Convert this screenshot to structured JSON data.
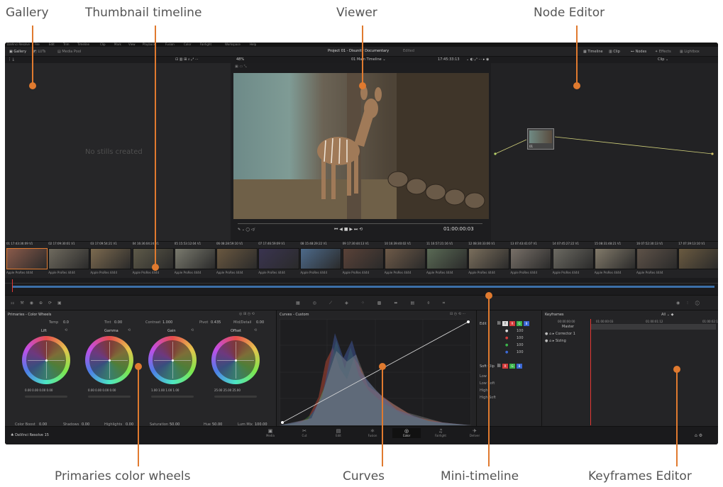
{
  "callouts": {
    "gallery": "Gallery",
    "thumbnail_timeline": "Thumbnail timeline",
    "viewer": "Viewer",
    "node_editor": "Node Editor",
    "primaries": "Primaries color wheels",
    "curves": "Curves",
    "mini_timeline": "Mini-timeline",
    "keyframes": "Keyframes Editor"
  },
  "menubar": {
    "app": "DaVinci Resolve",
    "items": [
      "File",
      "Edit",
      "Trim",
      "Timeline",
      "Clip",
      "Mark",
      "View",
      "Playback",
      "Fusion",
      "Color",
      "Fairlight",
      "Workspace",
      "Help"
    ]
  },
  "header": {
    "gallery": "Gallery",
    "luts": "LUTs",
    "media_pool": "Media Pool",
    "project_title": "Project 01 - Disunity Documentary",
    "project_status": "Edited",
    "timeline": "Timeline",
    "clip": "Clip",
    "nodes": "Nodes",
    "effects": "Effects",
    "lightbox": "Lightbox"
  },
  "subbar": {
    "zoom": "48%",
    "timeline_name": "01 Main Timeline",
    "timecode": "17:45:33:13",
    "clip_mode": "Clip"
  },
  "gallery": {
    "empty_text": "No stills created"
  },
  "viewer": {
    "timecode": "01:00:00:03"
  },
  "node": {
    "label": "01"
  },
  "clips": [
    {
      "num": "01",
      "tc": "17:43:36:09",
      "track": "V1",
      "label": "Apple ProRes 4444",
      "color": "#8a5a4a"
    },
    {
      "num": "02",
      "tc": "17:09:30:01",
      "track": "V1",
      "label": "Apple ProRes 4444",
      "color": "#6f6a5e"
    },
    {
      "num": "03",
      "tc": "17:09:54:21",
      "track": "V1",
      "label": "Apple ProRes 4444",
      "color": "#7c6a4f"
    },
    {
      "num": "04",
      "tc": "16:36:04:24",
      "track": "V1",
      "label": "Apple ProRes 4444",
      "color": "#5e5a49"
    },
    {
      "num": "05",
      "tc": "15:53:12:04",
      "track": "V1",
      "label": "Apple ProRes 4444",
      "color": "#7a7a6e"
    },
    {
      "num": "06",
      "tc": "08:28:59:10",
      "track": "V1",
      "label": "Apple ProRes 4444",
      "color": "#6a5840"
    },
    {
      "num": "07",
      "tc": "17:46:59:09",
      "track": "V1",
      "label": "Apple ProRes 4444",
      "color": "#3a3450"
    },
    {
      "num": "08",
      "tc": "15:48:29:22",
      "track": "V1",
      "label": "Apple ProRes 4444",
      "color": "#4d6a8a"
    },
    {
      "num": "09",
      "tc": "17:30:44:13",
      "track": "V1",
      "label": "Apple ProRes 4444",
      "color": "#5a4238"
    },
    {
      "num": "10",
      "tc": "16:39:40:02",
      "track": "V1",
      "label": "Apple ProRes 4444",
      "color": "#6e5a48"
    },
    {
      "num": "11",
      "tc": "16:57:21:16",
      "track": "V1",
      "label": "Apple ProRes 4444",
      "color": "#5a6a55"
    },
    {
      "num": "12",
      "tc": "08:30:33:06",
      "track": "V1",
      "label": "Apple ProRes 4444",
      "color": "#7a6e5c"
    },
    {
      "num": "13",
      "tc": "07:43:41:07",
      "track": "V1",
      "label": "Apple ProRes 4444",
      "color": "#787068"
    },
    {
      "num": "14",
      "tc": "07:45:27:22",
      "track": "V1",
      "label": "Apple ProRes 4444",
      "color": "#6c6a62"
    },
    {
      "num": "15",
      "tc": "08:31:48:21",
      "track": "V1",
      "label": "Apple ProRes 4444",
      "color": "#827a6a"
    },
    {
      "num": "16",
      "tc": "07:52:30:13",
      "track": "V1",
      "label": "Apple ProRes 4444",
      "color": "#5e5248"
    },
    {
      "num": "17",
      "tc": "07:39:13:10",
      "track": "V1",
      "label": "",
      "color": "#6a5a40"
    }
  ],
  "primaries": {
    "title": "Primaries - Color Wheels",
    "temp_label": "Temp",
    "temp": "0.0",
    "tint_label": "Tint",
    "tint": "0.00",
    "contrast_label": "Contrast",
    "contrast": "1.000",
    "pivot_label": "Pivot",
    "pivot": "0.435",
    "middetail_label": "Mid/Detail",
    "middetail": "0.00",
    "wheels": [
      {
        "name": "Lift",
        "vals": "0.00  0.00  0.00  0.00"
      },
      {
        "name": "Gamma",
        "vals": "0.00  0.00  0.00  0.00"
      },
      {
        "name": "Gain",
        "vals": "1.00  1.00  1.00  1.00"
      },
      {
        "name": "Offset",
        "vals": "25.00  25.00  25.00"
      }
    ],
    "colorboost_label": "Color Boost",
    "colorboost": "0.00",
    "shadows_label": "Shadows",
    "shadows": "0.00",
    "highlights_label": "Highlights",
    "highlights": "0.00",
    "saturation_label": "Saturation",
    "saturation": "50.00",
    "hue_label": "Hue",
    "hue": "50.00",
    "lummix_label": "Lum Mix",
    "lummix": "100.00"
  },
  "curves": {
    "title": "Curves - Custom"
  },
  "edit_panel": {
    "edit_label": "Edit",
    "rows": [
      "100",
      "100",
      "100",
      "100"
    ],
    "softclip": "Soft Clip",
    "low": "Low",
    "lowsoft": "Low Soft",
    "high": "High",
    "highsoft": "High Soft"
  },
  "keyframes": {
    "title": "Keyframes",
    "filter": "All",
    "tc1": "00:00:00:00",
    "tc2": "01:00:00:03",
    "tc3": "01:00:01:12",
    "tc4": "01:00:02:1",
    "master": "Master",
    "corrector": "Corrector 1",
    "sizing": "Sizing"
  },
  "pages": [
    "Media",
    "Cut",
    "Edit",
    "Fusion",
    "Color",
    "Fairlight",
    "Deliver"
  ],
  "active_page": "Color",
  "footer": {
    "app": "DaVinci Resolve 15"
  },
  "accent": "#e07a2f"
}
